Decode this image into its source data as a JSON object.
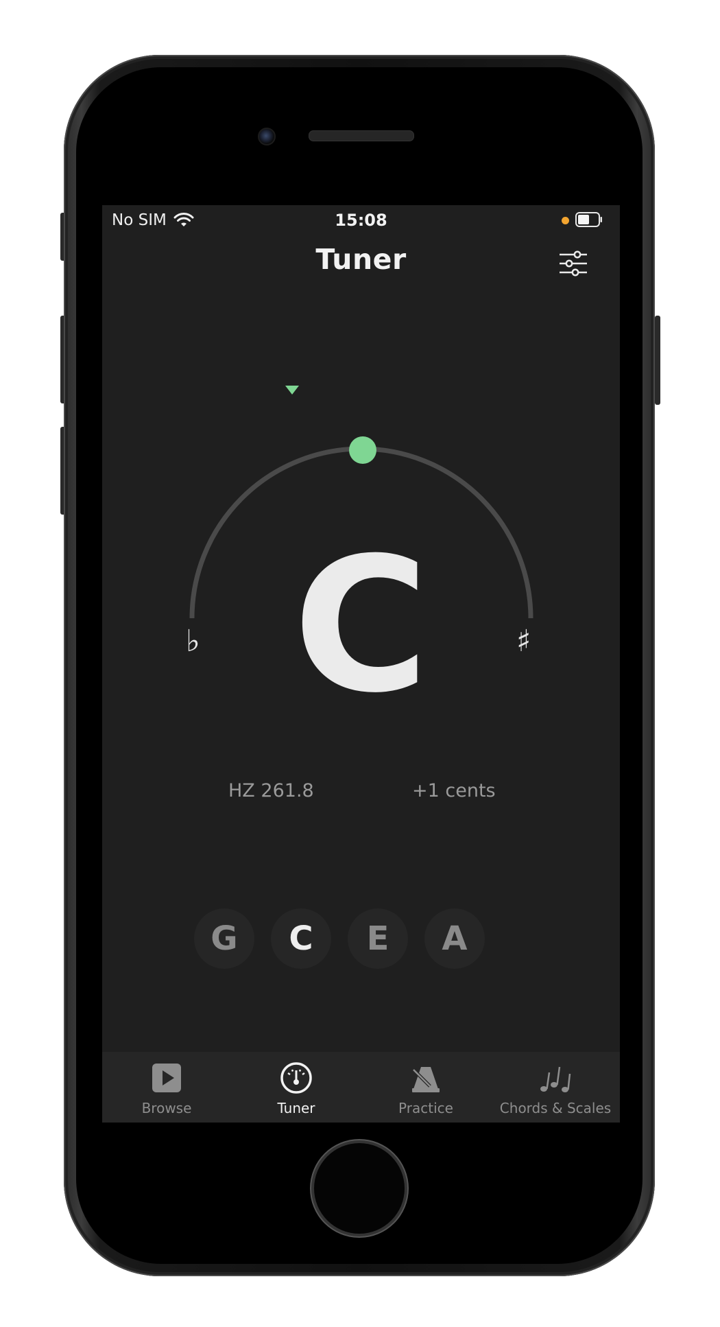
{
  "status_bar": {
    "carrier": "No SIM",
    "time": "15:08",
    "indicator_color": "#f3a530"
  },
  "nav": {
    "title": "Tuner",
    "settings_icon": "sliders-icon"
  },
  "tuner": {
    "note": "C",
    "flat_symbol": "♭",
    "sharp_symbol": "♯",
    "hz_label": "HZ",
    "hz_value": "261.8",
    "cents_value": "+1",
    "cents_label": "cents",
    "in_tune_color": "#7fd693"
  },
  "strings": [
    {
      "label": "G",
      "active": false
    },
    {
      "label": "C",
      "active": true
    },
    {
      "label": "E",
      "active": false
    },
    {
      "label": "A",
      "active": false
    }
  ],
  "tabs": [
    {
      "label": "Browse",
      "icon": "play-square-icon",
      "active": false
    },
    {
      "label": "Tuner",
      "icon": "tuner-gauge-icon",
      "active": true
    },
    {
      "label": "Practice",
      "icon": "metronome-icon",
      "active": false
    },
    {
      "label": "Chords & Scales",
      "icon": "music-notes-icon",
      "active": false
    }
  ]
}
